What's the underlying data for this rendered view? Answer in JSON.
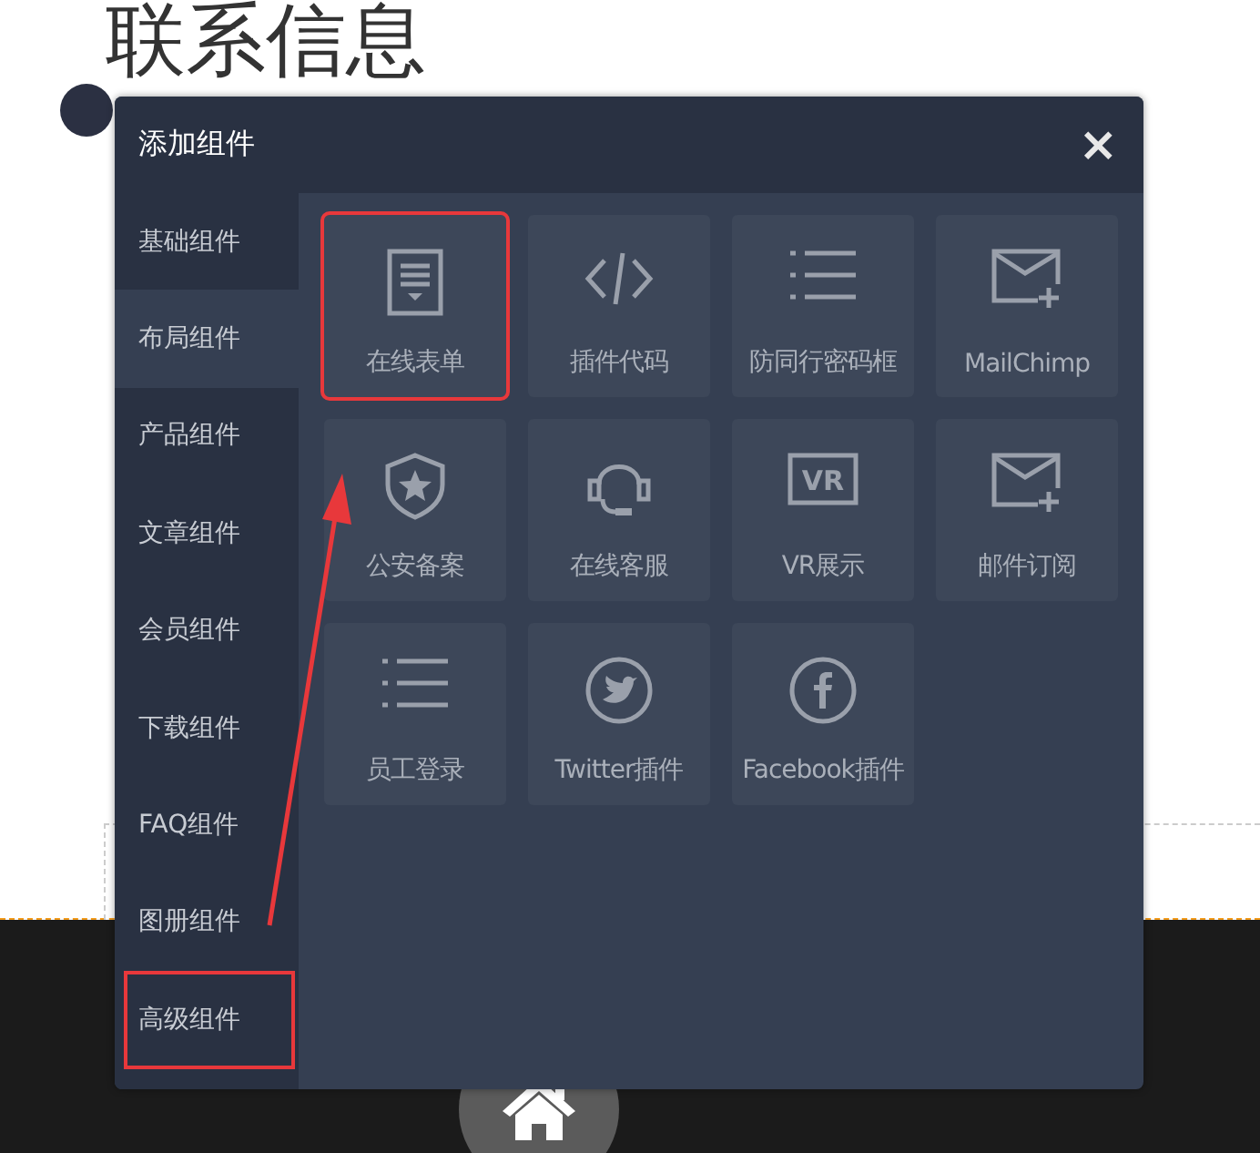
{
  "page": {
    "heading": "联系信息"
  },
  "dialog": {
    "title": "添加组件",
    "close": "×",
    "categories": [
      {
        "label": "基础组件",
        "selected": false,
        "marked": false
      },
      {
        "label": "布局组件",
        "selected": true,
        "marked": false
      },
      {
        "label": "产品组件",
        "selected": false,
        "marked": false
      },
      {
        "label": "文章组件",
        "selected": false,
        "marked": false
      },
      {
        "label": "会员组件",
        "selected": false,
        "marked": false
      },
      {
        "label": "下载组件",
        "selected": false,
        "marked": false
      },
      {
        "label": "FAQ组件",
        "selected": false,
        "marked": false
      },
      {
        "label": "图册组件",
        "selected": false,
        "marked": false
      },
      {
        "label": "高级组件",
        "selected": false,
        "marked": true
      }
    ],
    "widgets": [
      {
        "label": "在线表单",
        "kind": "form",
        "marked": true
      },
      {
        "label": "插件代码",
        "kind": "code",
        "marked": false
      },
      {
        "label": "防同行密码框",
        "kind": "list",
        "marked": false
      },
      {
        "label": "MailChimp",
        "kind": "mail",
        "marked": false
      },
      {
        "label": "公安备案",
        "kind": "shield",
        "marked": false
      },
      {
        "label": "在线客服",
        "kind": "headset",
        "marked": false
      },
      {
        "label": "VR展示",
        "kind": "vr",
        "icon_text": "VR",
        "marked": false
      },
      {
        "label": "邮件订阅",
        "kind": "mail",
        "marked": false
      },
      {
        "label": "员工登录",
        "kind": "list",
        "marked": false
      },
      {
        "label": "Twitter插件",
        "kind": "twitter",
        "marked": false
      },
      {
        "label": "Facebook插件",
        "kind": "facebook",
        "marked": false
      }
    ]
  },
  "annotation": {
    "arrow": true
  }
}
